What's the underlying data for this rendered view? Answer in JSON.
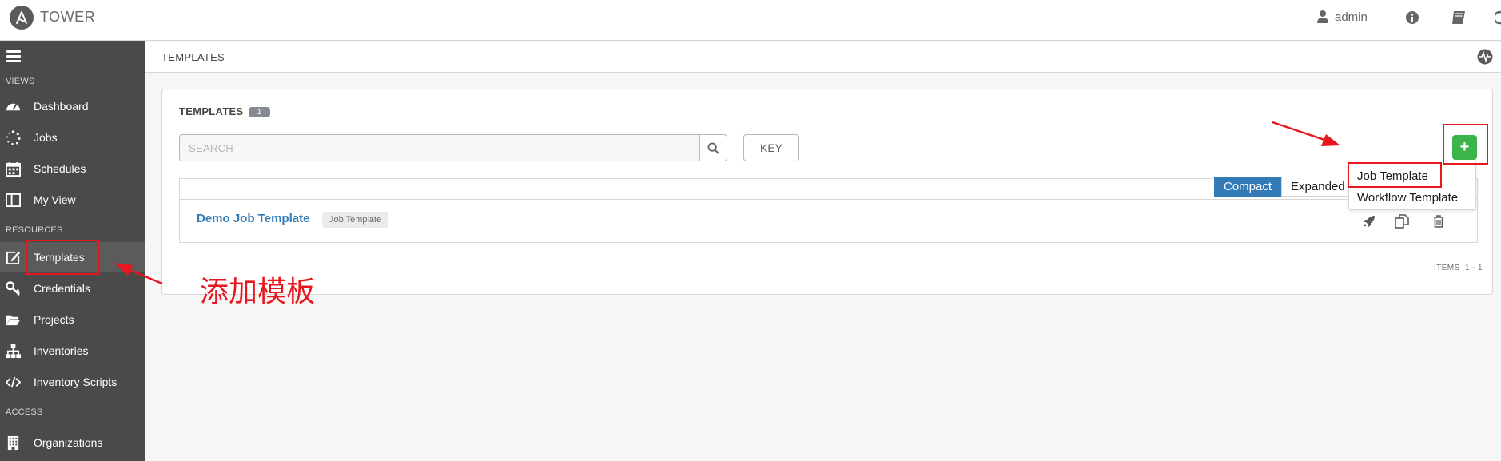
{
  "app": {
    "name": "TOWER"
  },
  "topbar": {
    "user": "admin"
  },
  "sidebar": {
    "sections": [
      {
        "heading": "VIEWS"
      },
      {
        "heading": "RESOURCES"
      },
      {
        "heading": "ACCESS"
      }
    ],
    "items": [
      {
        "label": "Dashboard",
        "icon": "dashboard-icon"
      },
      {
        "label": "Jobs",
        "icon": "jobs-icon"
      },
      {
        "label": "Schedules",
        "icon": "calendar-icon"
      },
      {
        "label": "My View",
        "icon": "columns-icon"
      },
      {
        "label": "Templates",
        "icon": "edit-icon"
      },
      {
        "label": "Credentials",
        "icon": "key-icon"
      },
      {
        "label": "Projects",
        "icon": "folder-icon"
      },
      {
        "label": "Inventories",
        "icon": "sitemap-icon"
      },
      {
        "label": "Inventory Scripts",
        "icon": "code-icon"
      },
      {
        "label": "Organizations",
        "icon": "building-icon"
      }
    ]
  },
  "page": {
    "breadcrumb": "TEMPLATES"
  },
  "panel": {
    "title": "TEMPLATES",
    "count": "1",
    "search_placeholder": "SEARCH",
    "key_label": "KEY",
    "add_label": "+",
    "view_options": [
      "Compact",
      "Expanded"
    ],
    "rows": [
      {
        "name": "Demo Job Template",
        "type": "Job Template"
      }
    ],
    "items_label": "ITEMS",
    "items_range": "1 - 1"
  },
  "dropdown": {
    "items": [
      "Job Template",
      "Workflow Template"
    ]
  },
  "annotation": {
    "text": "添加模板",
    "color": "#e8161d"
  },
  "colors": {
    "sidebar_bg": "#4a4a4a",
    "link": "#337ab7",
    "add_button": "#3cb44c"
  }
}
